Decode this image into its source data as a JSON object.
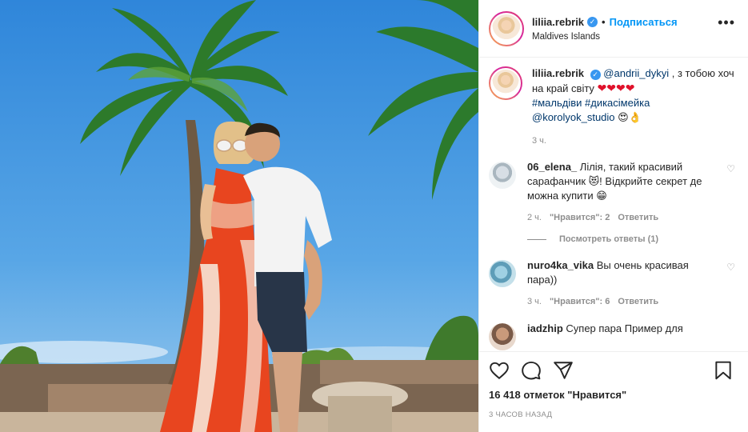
{
  "post": {
    "username": "liliia.rebrik",
    "follow_label": "Подписаться",
    "location": "Maldives Islands",
    "more_icon": "more-options-icon"
  },
  "caption": {
    "username": "liliia.rebrik",
    "mention": "@andrii_dykyi",
    "text_1": " , з тобою хоч на край світу ",
    "hearts": "❤❤❤❤",
    "hashtags": "#мальдіви #дикасімейка",
    "studio": "@korolyok_studio",
    "emoji": "😍👌",
    "time": "3 ч."
  },
  "comments": [
    {
      "username": "06_elena_",
      "text": " Лілія, такий красивий сарафанчик 😻! Відкрийте секрет де можна купити 😁",
      "time": "2 ч.",
      "likes": "\"Нравится\": 2",
      "reply": "Ответить",
      "view_replies": "Посмотреть ответы (1)"
    },
    {
      "username": "nuro4ka_vika",
      "text": " Вы очень красивая пара))",
      "time": "3 ч.",
      "likes": "\"Нравится\": 6",
      "reply": "Ответить"
    },
    {
      "username": "iadzhip",
      "text": " Супер пара Пример для"
    }
  ],
  "actions": {
    "like_icon": "heart-icon",
    "comment_icon": "comment-icon",
    "share_icon": "share-icon",
    "save_icon": "bookmark-icon",
    "likes_text": "16 418 отметок \"Нравится\"",
    "posted": "3 ЧАСОВ НАЗАД"
  },
  "colors": {
    "accent": "#0095f6",
    "sky": "#3f93e0",
    "dress": "#e8451f"
  }
}
